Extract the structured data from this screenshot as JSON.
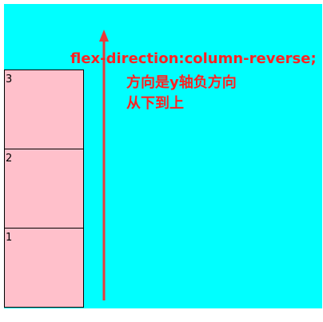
{
  "colors": {
    "stage_background": "#00ffff",
    "item_background": "#ffc0cb",
    "annotation": "#ff2222"
  },
  "items": [
    {
      "label": "1"
    },
    {
      "label": "2"
    },
    {
      "label": "3"
    }
  ],
  "annotation": {
    "title": "flex-direction:column-reverse;",
    "line1": "方向是y轴负方向",
    "line2": "从下到上"
  }
}
